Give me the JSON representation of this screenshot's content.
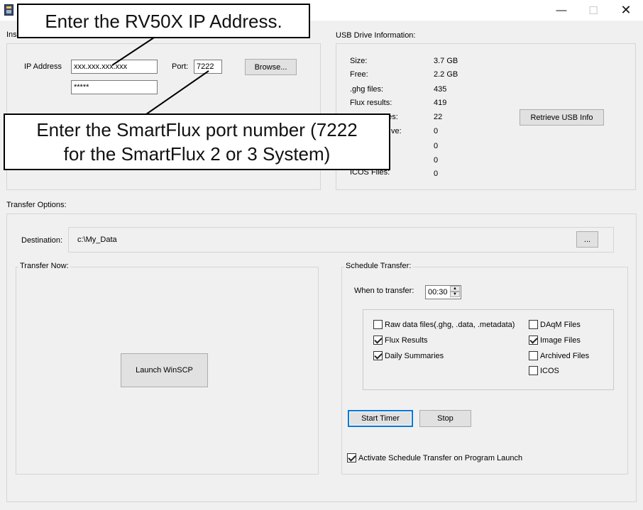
{
  "window": {
    "minimize_glyph": "—",
    "maximize_glyph": "☐",
    "close_glyph": "✕"
  },
  "instrument": {
    "group_label_partial": "Ins",
    "ip_label": "IP Address",
    "ip_value": "xxx.xxx.xxx.xxx",
    "password_value": "*****",
    "port_label": "Port:",
    "port_value": "7222",
    "browse_label": "Browse..."
  },
  "usb": {
    "group_label": "USB Drive Information:",
    "rows": [
      {
        "label": "Size:",
        "value": "3.7 GB"
      },
      {
        "label": "Free:",
        "value": "2.2 GB"
      },
      {
        "label": ".ghg files:",
        "value": "435"
      },
      {
        "label": "Flux results:",
        "value": "419"
      },
      {
        "label": "ries:",
        "value": "22"
      },
      {
        "label": "ve:",
        "value": "0"
      },
      {
        "label": "",
        "value": "0"
      },
      {
        "label": "",
        "value": "0"
      },
      {
        "label": "ICOS Files:",
        "value": "0"
      }
    ],
    "retrieve_label": "Retrieve USB Info"
  },
  "transfer": {
    "group_label": "Transfer Options:",
    "destination_label": "Destination:",
    "destination_value": "c:\\My_Data",
    "dest_browse_label": "...",
    "now_label": "Transfer Now:",
    "launch_label": "Launch WinSCP",
    "schedule_label": "Schedule Transfer:",
    "when_label": "When to transfer:",
    "when_value": "00:30",
    "files": {
      "raw": {
        "label": "Raw data files(.ghg, .data, .metadata)",
        "checked": false
      },
      "flux": {
        "label": "Flux Results",
        "checked": true
      },
      "daily": {
        "label": "Daily Summaries",
        "checked": true
      },
      "daqm": {
        "label": "DAqM Files",
        "checked": false
      },
      "image": {
        "label": "Image Files",
        "checked": true
      },
      "archived": {
        "label": "Archived Files",
        "checked": false
      },
      "icos": {
        "label": "ICOS",
        "checked": false
      }
    },
    "start_label": "Start Timer",
    "stop_label": "Stop",
    "activate_label": "Activate Schedule Transfer on Program Launch",
    "activate_checked": true
  },
  "callouts": {
    "ip": "Enter the RV50X IP Address.",
    "port_line1": "Enter the SmartFlux port number (7222",
    "port_line2": "for the SmartFlux 2 or 3 System)"
  }
}
